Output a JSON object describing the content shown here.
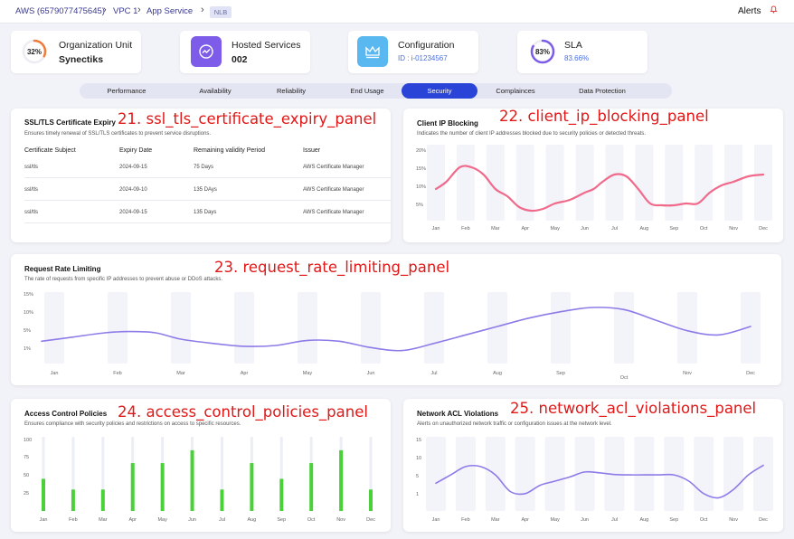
{
  "breadcrumb": {
    "account": "AWS (6579077475645)",
    "vpc": "VPC 1",
    "service": "App Service",
    "badge": "NLB"
  },
  "alerts_label": "Alerts",
  "stats": {
    "org": {
      "label": "Organization Unit",
      "value": "Synectiks",
      "ring_text": "32%",
      "ring_pct": 32
    },
    "hosted": {
      "label": "Hosted Services",
      "value": "002"
    },
    "config": {
      "label": "Configuration",
      "value": "ID : i-01234567"
    },
    "sla": {
      "label": "SLA",
      "value": "83.66%",
      "ring_text": "83%",
      "ring_pct": 83
    }
  },
  "tabs": [
    "Performance",
    "Availability",
    "Reliability",
    "End Usage",
    "Security",
    "Complainces",
    "Data Protection"
  ],
  "active_tab": "Security",
  "ssl": {
    "title": "SSL/TLS Certificate Expiry",
    "annotation": "21. ssl_tls_certificate_expiry_panel",
    "subtitle": "Ensures timely renewal of SSL/TLS certificates to prevent service disruptions.",
    "headers": [
      "Certificate Subject",
      "Expiry Date",
      "Remaining validity Period",
      "Issuer"
    ],
    "rows": [
      [
        "ssl/tls",
        "2024-09-15",
        "75 Days",
        "AWS Certificate Manager"
      ],
      [
        "ssl/tls",
        "2024-09-10",
        "135 DAys",
        "AWS Certificate Manager"
      ],
      [
        "ssl/tls",
        "2024-09-15",
        "135 Days",
        "AWS Certificate Manager"
      ]
    ]
  },
  "client_ip": {
    "title": "Client IP Blocking",
    "annotation": "22. client_ip_blocking_panel",
    "subtitle": "Indicates the number of client IP addresses blocked due to security policies or detected threats.",
    "chart_data": {
      "type": "line",
      "categories": [
        "Jan",
        "Feb",
        "Mar",
        "Apr",
        "May",
        "Jun",
        "Jul",
        "Aug",
        "Sep",
        "Oct",
        "Nov",
        "Dec"
      ],
      "yticks": [
        "20%",
        "15%",
        "10%",
        "5%"
      ],
      "ylim": [
        0,
        20
      ],
      "x": [
        0,
        0.35,
        0.8,
        1.2,
        1.6,
        2.0,
        2.4,
        2.8,
        3.2,
        3.6,
        4.0,
        4.5,
        5.0,
        5.3,
        5.6,
        6.0,
        6.4,
        6.8,
        7.2,
        7.6,
        8.0,
        8.4,
        8.8,
        9.2,
        9.6,
        10.0,
        10.5,
        11.0
      ],
      "y": [
        9,
        11,
        15,
        15,
        13,
        9,
        7,
        4,
        3,
        3.5,
        5,
        6,
        8,
        9,
        11,
        13,
        12.5,
        9,
        5,
        4.5,
        4.5,
        5,
        5,
        8,
        10,
        11,
        12.5,
        13
      ],
      "color": "#f06b8b"
    }
  },
  "request_rate": {
    "title": "Request Rate Limiting",
    "annotation": "23. request_rate_limiting_panel",
    "subtitle": "The rate of requests from specific IP addresses to prevent abuse or DDoS attacks.",
    "chart_data": {
      "type": "line",
      "categories": [
        "Jan",
        "Feb",
        "Mar",
        "Apr",
        "May",
        "Jun",
        "Jul",
        "Aug",
        "Sep",
        "Oct",
        "Nov",
        "Dec"
      ],
      "yticks": [
        "15%",
        "10%",
        "5%",
        "1%"
      ],
      "ylim": [
        0,
        15
      ],
      "x": [
        -0.2,
        0.3,
        0.8,
        1.2,
        1.6,
        2.0,
        2.5,
        3.0,
        3.5,
        4.0,
        4.5,
        5.0,
        5.5,
        6.0,
        6.5,
        7.0,
        7.5,
        8.0,
        8.5,
        9.0,
        9.5,
        10.0,
        10.5,
        11.0
      ],
      "y": [
        4,
        5,
        6,
        6.3,
        6,
        4.5,
        3.5,
        2.8,
        3,
        4.2,
        4,
        2.5,
        1.8,
        3.5,
        5.5,
        7.5,
        9.5,
        11,
        12,
        11.5,
        9,
        6.5,
        5.5,
        7.5
      ],
      "color": "#8e7be8"
    }
  },
  "access_control": {
    "title": "Access Control Policies",
    "annotation": "24. access_control_policies_panel",
    "subtitle": "Ensures compliance with security policies and restrictions on access to specific resources.",
    "chart_data": {
      "type": "bar",
      "categories": [
        "Jan",
        "Feb",
        "Mar",
        "Apr",
        "May",
        "Jun",
        "Jul",
        "Aug",
        "Sep",
        "Oct",
        "Nov",
        "Dec"
      ],
      "values": [
        45,
        30,
        30,
        67,
        67,
        85,
        30,
        67,
        45,
        67,
        85,
        30
      ],
      "yticks": [
        "100",
        "75",
        "50",
        "25"
      ],
      "ylim": [
        0,
        100
      ],
      "color": "#4ad13a"
    }
  },
  "network_acl": {
    "title": "Network ACL Violations",
    "annotation": "25. network_acl_violations_panel",
    "subtitle": "Alerts on unauthorized network traffic or configuration issues at the network level.",
    "chart_data": {
      "type": "line",
      "categories": [
        "Jan",
        "Feb",
        "Mar",
        "Apr",
        "May",
        "Jun",
        "Jul",
        "Aug",
        "Sep",
        "Oct",
        "Nov",
        "Dec"
      ],
      "yticks": [
        "15",
        "10",
        "5",
        "1"
      ],
      "ylim": [
        0,
        15
      ],
      "x": [
        0,
        0.5,
        1.0,
        1.5,
        2.0,
        2.5,
        3.0,
        3.5,
        4.0,
        4.5,
        5.0,
        5.5,
        6.0,
        6.5,
        7.0,
        7.5,
        8.0,
        8.5,
        9.0,
        9.5,
        10.0,
        10.5,
        11.0
      ],
      "y": [
        4.5,
        6.5,
        8.5,
        8.5,
        6.5,
        2.5,
        2,
        4,
        5,
        6,
        7.2,
        7,
        6.6,
        6.5,
        6.5,
        6.5,
        6.5,
        5,
        2,
        1,
        3,
        6.5,
        8.8
      ],
      "color": "#8e7be8"
    }
  }
}
